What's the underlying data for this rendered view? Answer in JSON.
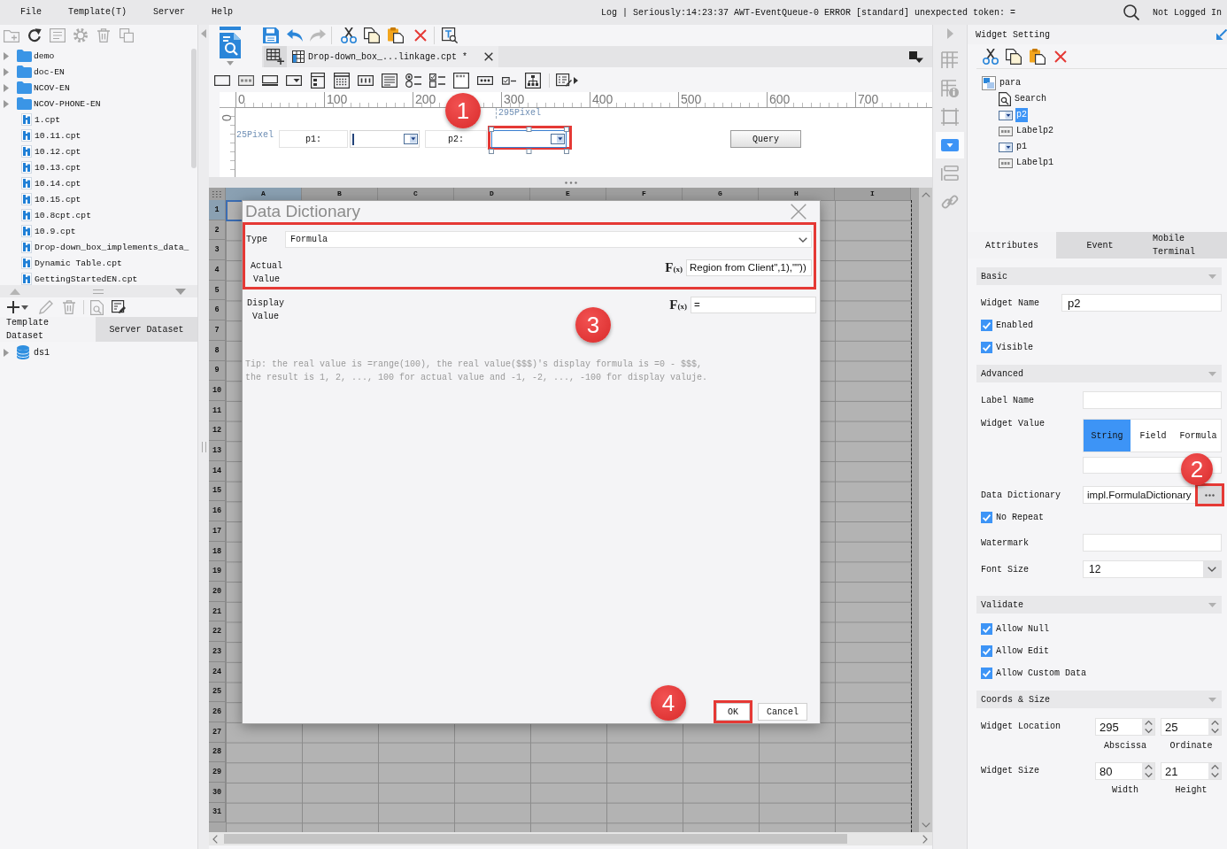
{
  "menu_bar": {
    "items": [
      "File",
      "Template(T)",
      "Server",
      "Help"
    ],
    "log": "Log | Seriously:14:23:37 AWT-EventQueue-0 ERROR [standard] unexpected token: =",
    "login_status": "Not Logged In"
  },
  "template_tree": {
    "items": [
      {
        "kind": "folder",
        "label": "demo",
        "expanded": false
      },
      {
        "kind": "folder",
        "label": "doc-EN",
        "expanded": false
      },
      {
        "kind": "folder",
        "label": "NCOV-EN",
        "expanded": false
      },
      {
        "kind": "folder",
        "label": "NCOV-PHONE-EN",
        "expanded": false
      },
      {
        "kind": "file",
        "label": "1.cpt"
      },
      {
        "kind": "file",
        "label": "10.11.cpt"
      },
      {
        "kind": "file",
        "label": "10.12.cpt"
      },
      {
        "kind": "file",
        "label": "10.13.cpt"
      },
      {
        "kind": "file",
        "label": "10.14.cpt"
      },
      {
        "kind": "file",
        "label": "10.15.cpt"
      },
      {
        "kind": "file",
        "label": "10.8cpt.cpt"
      },
      {
        "kind": "file",
        "label": "10.9.cpt"
      },
      {
        "kind": "file",
        "label": "Drop-down_box_implements_data_"
      },
      {
        "kind": "file",
        "label": "Dynamic Table.cpt"
      },
      {
        "kind": "file",
        "label": "GettingStartedEN.cpt"
      }
    ]
  },
  "dataset_panel": {
    "tabs": [
      {
        "label": "Template Dataset",
        "selected": true
      },
      {
        "label": "Server Dataset",
        "selected": false
      }
    ],
    "items": [
      {
        "label": "ds1",
        "expanded": false
      }
    ]
  },
  "editor": {
    "file_tab": "Drop-down_box_...linkage.cpt *",
    "ruler": [
      "0",
      "100",
      "200",
      "300",
      "400",
      "500",
      "600",
      "700"
    ],
    "vertical_ruler": "0",
    "canvas": {
      "ordinate_guide": "25Pixel",
      "abscissa_guide": "295Pixel",
      "widgets": [
        {
          "kind": "label",
          "text": "p1:"
        },
        {
          "kind": "combo",
          "focused": true,
          "selected": false,
          "highlighted": false
        },
        {
          "kind": "label",
          "text": "p2:"
        },
        {
          "kind": "combo",
          "focused": false,
          "selected": true,
          "highlighted": true
        },
        {
          "kind": "button",
          "text": "Query"
        }
      ]
    },
    "spreadsheet": {
      "columns": [
        {
          "label": "A",
          "selected": true
        },
        {
          "label": "B",
          "selected": false
        },
        {
          "label": "C",
          "selected": false
        },
        {
          "label": "D",
          "selected": false
        },
        {
          "label": "E",
          "selected": false
        },
        {
          "label": "F",
          "selected": false
        },
        {
          "label": "G",
          "selected": false
        },
        {
          "label": "H",
          "selected": false
        },
        {
          "label": "I",
          "selected": false
        }
      ],
      "rows": [
        {
          "label": "1",
          "selected": true
        },
        {
          "label": "2",
          "selected": false
        },
        {
          "label": "3",
          "selected": false
        },
        {
          "label": "4",
          "selected": false
        },
        {
          "label": "5",
          "selected": false
        },
        {
          "label": "6",
          "selected": false
        },
        {
          "label": "7",
          "selected": false
        },
        {
          "label": "8",
          "selected": false
        },
        {
          "label": "9",
          "selected": false
        },
        {
          "label": "10",
          "selected": false
        },
        {
          "label": "11",
          "selected": false
        },
        {
          "label": "12",
          "selected": false
        },
        {
          "label": "13",
          "selected": false
        },
        {
          "label": "14",
          "selected": false
        },
        {
          "label": "15",
          "selected": false
        },
        {
          "label": "16",
          "selected": false
        },
        {
          "label": "17",
          "selected": false
        },
        {
          "label": "18",
          "selected": false
        },
        {
          "label": "19",
          "selected": false
        },
        {
          "label": "20",
          "selected": false
        },
        {
          "label": "21",
          "selected": false
        },
        {
          "label": "22",
          "selected": false
        },
        {
          "label": "23",
          "selected": false
        },
        {
          "label": "24",
          "selected": false
        },
        {
          "label": "25",
          "selected": false
        },
        {
          "label": "26",
          "selected": false
        },
        {
          "label": "27",
          "selected": false
        },
        {
          "label": "28",
          "selected": false
        },
        {
          "label": "29",
          "selected": false
        },
        {
          "label": "30",
          "selected": false
        },
        {
          "label": "31",
          "selected": false
        }
      ]
    }
  },
  "dialog": {
    "title": "Data Dictionary",
    "main_fields": {
      "highlighted": true,
      "type": {
        "label": "Type",
        "value": "Formula"
      },
      "actual_value": {
        "label": "Actual Value",
        "formula_button": "F$_{(x)}$",
        "value": "Region from Client\",1),\"\"))"
      }
    },
    "display_value": {
      "label": "Display Value",
      "formula_button": "F$_{(x)}$",
      "value": "="
    },
    "tip": [
      "Tip: the real value is =range(100), the real value($$$)'s display formula is =0 - $$$,",
      "the result is 1, 2, ..., 100 for actual value and -1, -2, ..., -100 for display valuje."
    ],
    "buttons": [
      {
        "label": "OK",
        "highlighted": true
      },
      {
        "label": "Cancel",
        "highlighted": false
      }
    ]
  },
  "side_strip": {
    "tabs": [
      {
        "selected": false
      },
      {
        "selected": false
      },
      {
        "selected": false
      },
      {
        "selected": true
      },
      {
        "selected": false
      },
      {
        "selected": false
      }
    ]
  },
  "widget_panel": {
    "title": "Widget Setting",
    "tree": [
      {
        "kind": "layout",
        "label": "para",
        "selected": false,
        "children": [
          {
            "kind": "search",
            "label": "Search",
            "selected": false
          },
          {
            "kind": "combo",
            "label": "p2",
            "selected": true
          },
          {
            "kind": "label",
            "label": "Labelp2",
            "selected": false
          },
          {
            "kind": "combo",
            "label": "p1",
            "selected": false
          },
          {
            "kind": "label",
            "label": "Labelp1",
            "selected": false
          }
        ]
      }
    ],
    "tabs": [
      {
        "label": "Attributes",
        "selected": true
      },
      {
        "label": "Event",
        "selected": false
      },
      {
        "label": "Mobile Terminal",
        "selected": false
      }
    ],
    "sections": [
      {
        "title": "Basic",
        "expanded": true,
        "rows": [
          {
            "kind": "text",
            "label": "Widget Name",
            "value": "p2"
          },
          {
            "kind": "check",
            "label": "Enabled",
            "checked": true
          },
          {
            "kind": "check",
            "label": "Visible",
            "checked": true
          }
        ]
      },
      {
        "title": "Advanced",
        "expanded": true,
        "rows": [
          {
            "kind": "text",
            "label": "Label Name"
          },
          {
            "kind": "segmented",
            "label": "Widget Value",
            "options": [
              {
                "label": "String",
                "selected": true
              },
              {
                "label": "Field",
                "selected": false
              },
              {
                "label": "Formula",
                "selected": false
              }
            ]
          },
          {
            "kind": "picker",
            "label": "Data Dictionary",
            "value": "impl.FormulaDictionary",
            "highlighted": true
          },
          {
            "kind": "check",
            "label": "No Repeat",
            "checked": true
          },
          {
            "kind": "text",
            "label": "Watermark"
          },
          {
            "kind": "select",
            "label": "Font Size",
            "value": "12"
          }
        ]
      },
      {
        "title": "Validate",
        "expanded": true,
        "rows": [
          {
            "kind": "check",
            "label": "Allow Null",
            "checked": true
          },
          {
            "kind": "check",
            "label": "Allow Edit",
            "checked": true
          },
          {
            "kind": "check",
            "label": "Allow Custom Data",
            "checked": true
          }
        ]
      },
      {
        "title": "Coords & Size",
        "expanded": true,
        "rows": [
          {
            "kind": "pair",
            "label": "Widget Location",
            "fields": [
              {
                "value": "295",
                "caption": "Abscissa"
              },
              {
                "value": "25",
                "caption": "Ordinate"
              }
            ]
          },
          {
            "kind": "pair",
            "label": "Widget Size",
            "fields": [
              {
                "value": "80",
                "caption": "Width"
              },
              {
                "value": "21",
                "caption": "Height"
              }
            ]
          }
        ]
      }
    ]
  },
  "annotations": [
    "1",
    "2",
    "3",
    "4"
  ]
}
